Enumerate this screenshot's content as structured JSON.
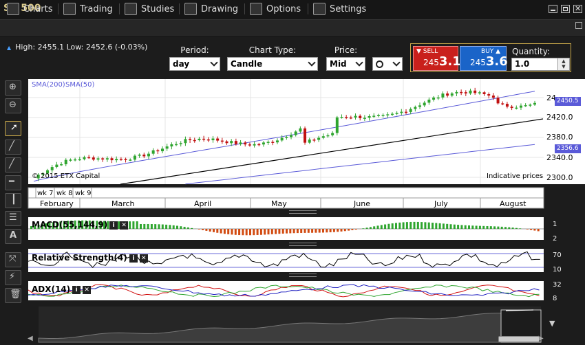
{
  "app": {
    "title": "SP 500"
  },
  "menu": [
    {
      "label": "Charts",
      "icon": "bar-chart-icon"
    },
    {
      "label": "Trading",
      "icon": "trade-arrows-icon"
    },
    {
      "label": "Studies",
      "icon": "studies-icon"
    },
    {
      "label": "Drawing",
      "icon": "pencil-icon"
    },
    {
      "label": "Options",
      "icon": "list-icon"
    },
    {
      "label": "Settings",
      "icon": "tools-icon"
    }
  ],
  "summary": {
    "text": "High: 2455.1 Low: 2452.6 (-0.03%)"
  },
  "controls": {
    "period_label": "Period:",
    "period_value": "day",
    "charttype_label": "Chart Type:",
    "charttype_value": "Candle",
    "price_label": "Price:",
    "price_value": "Mid"
  },
  "trade": {
    "sell_label": "SELL",
    "sell_prefix": "245",
    "sell_big": "3.1",
    "buy_label": "BUY",
    "buy_prefix": "245",
    "buy_big": "3.6",
    "quantity_label": "Quantity:",
    "quantity_value": "1.0"
  },
  "colors": {
    "up": "#2fa52f",
    "down": "#c01010",
    "sma": "#5a5ad8",
    "accent": "#c9a94a"
  },
  "chart": {
    "legend_sma200": "SMA(200)",
    "legend_sma50": "SMA(50)",
    "copyright": "© 2015 ETX Capital",
    "indicative": "Indicative prices",
    "price_ticks": [
      "2420.0",
      "2380.0",
      "2340.0",
      "2300.0"
    ],
    "top_tick": "24",
    "marker_price1": "2450.5",
    "marker_price2": "2356.6",
    "weeks": [
      "wk 7",
      "wk 8",
      "wk 9"
    ],
    "months": [
      "February",
      "March",
      "April",
      "May",
      "June",
      "July",
      "August"
    ]
  },
  "indicators": {
    "macd": {
      "label": "MACD(55,144,9)",
      "ticks": [
        "1",
        "2"
      ]
    },
    "rsi": {
      "label": "Relative Strength(4)",
      "ticks": [
        "70",
        "10"
      ]
    },
    "adx": {
      "label": "ADX(14)",
      "ticks": [
        "32",
        "8"
      ]
    }
  },
  "chart_data": {
    "type": "candlestick",
    "title": "",
    "ylim": [
      2290,
      2470
    ],
    "x_months": [
      "February",
      "March",
      "April",
      "May",
      "June",
      "July",
      "August"
    ],
    "series": [
      {
        "name": "SMA(200)",
        "y_range": [
          2290,
          2358
        ]
      },
      {
        "name": "SMA(50)",
        "y_range": [
          2295,
          2450
        ]
      }
    ],
    "close_start": 2300,
    "close_end": 2450.5,
    "last_sma200": 2356.6
  }
}
